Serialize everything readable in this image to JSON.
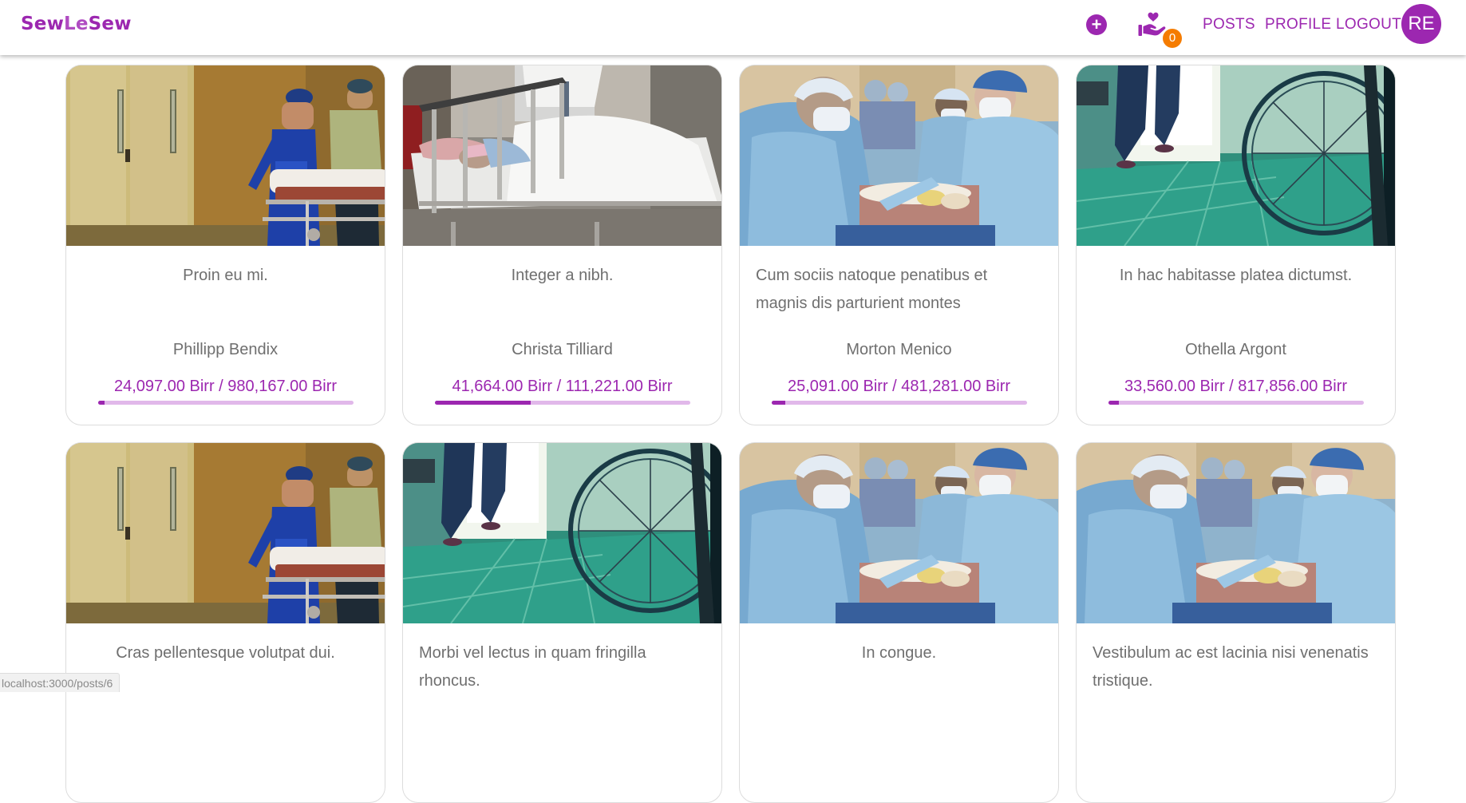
{
  "brand": {
    "part1": "Sew",
    "part2": "Le",
    "part3": "Sew"
  },
  "colors": {
    "accent": "#9c27b0",
    "accent_light": "#e1b8ea",
    "badge": "#f57c00",
    "text_muted": "#6f6f6f"
  },
  "navbar": {
    "add_icon": "add-circle-icon",
    "donations_icon": "hand-heart-icon",
    "donations_count": "0",
    "links": [
      "POSTS",
      "PROFILE",
      "LOGOUT"
    ],
    "avatar_initials": "RE"
  },
  "posts": [
    {
      "title": "Proin eu mi.",
      "author": "Phillipp Bendix",
      "raised": "24,097.00 Birr",
      "goal": "980,167.00 Birr",
      "amount_text": "24,097.00 Birr / 980,167.00 Birr",
      "progress_percent": 2.5,
      "image": "paramedics-stretcher"
    },
    {
      "title": "Integer a nibh.",
      "author": "Christa Tilliard",
      "raised": "41,664.00 Birr",
      "goal": "111,221.00 Birr",
      "amount_text": "41,664.00 Birr / 111,221.00 Birr",
      "progress_percent": 37.5,
      "image": "hospital-bed"
    },
    {
      "title": "Cum sociis natoque penatibus et magnis dis parturient montes",
      "author": "Morton Menico",
      "raised": "25,091.00 Birr",
      "goal": "481,281.00 Birr",
      "amount_text": "25,091.00 Birr / 481,281.00 Birr",
      "progress_percent": 5.2,
      "image": "surgeons-operating"
    },
    {
      "title": "In hac habitasse platea dictumst.",
      "author": "Othella Argont",
      "raised": "33,560.00 Birr",
      "goal": "817,856.00 Birr",
      "amount_text": "33,560.00 Birr / 817,856.00 Birr",
      "progress_percent": 4.1,
      "image": "wheelchair-corridor"
    },
    {
      "title": "Cras pellentesque volutpat dui.",
      "image": "paramedics-stretcher"
    },
    {
      "title": "Morbi vel lectus in quam fringilla rhoncus.",
      "image": "wheelchair-corridor"
    },
    {
      "title": "In congue.",
      "image": "surgeons-operating"
    },
    {
      "title": "Vestibulum ac est lacinia nisi venenatis tristique.",
      "image": "surgeons-operating"
    }
  ],
  "status_bar": {
    "url": "localhost:3000/posts/6"
  }
}
